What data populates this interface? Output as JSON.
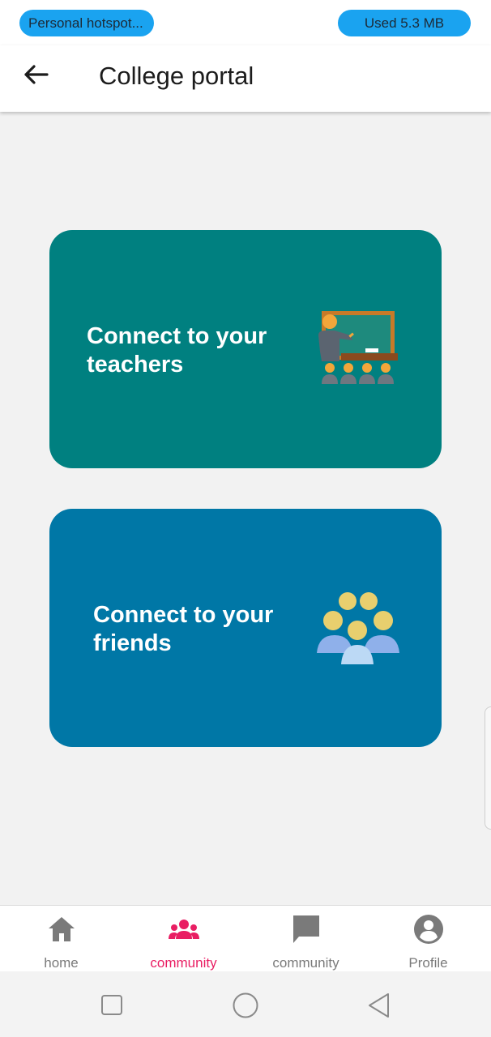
{
  "status": {
    "network_label": "Personal hotspot...",
    "data_used": "Used  5.3 MB",
    "pill_color": "#1aa3f0"
  },
  "appbar": {
    "back_icon": "arrow-back-icon",
    "title": "College portal"
  },
  "cards": [
    {
      "label": "Connect to your teachers",
      "icon": "teacher-classroom-icon",
      "color": "#008080"
    },
    {
      "label": "Connect to your friends",
      "icon": "friends-group-icon",
      "color": "#0077a6"
    }
  ],
  "bottom_nav": {
    "active_color": "#e91e63",
    "items": [
      {
        "label": "home",
        "icon": "home-icon",
        "active": false
      },
      {
        "label": "community",
        "icon": "group-icon",
        "active": true
      },
      {
        "label": "community",
        "icon": "chat-icon",
        "active": false
      },
      {
        "label": "Profile",
        "icon": "account-circle-icon",
        "active": false
      }
    ]
  },
  "system_nav": {
    "buttons": [
      "recents-square-icon",
      "home-circle-icon",
      "back-triangle-icon"
    ]
  }
}
